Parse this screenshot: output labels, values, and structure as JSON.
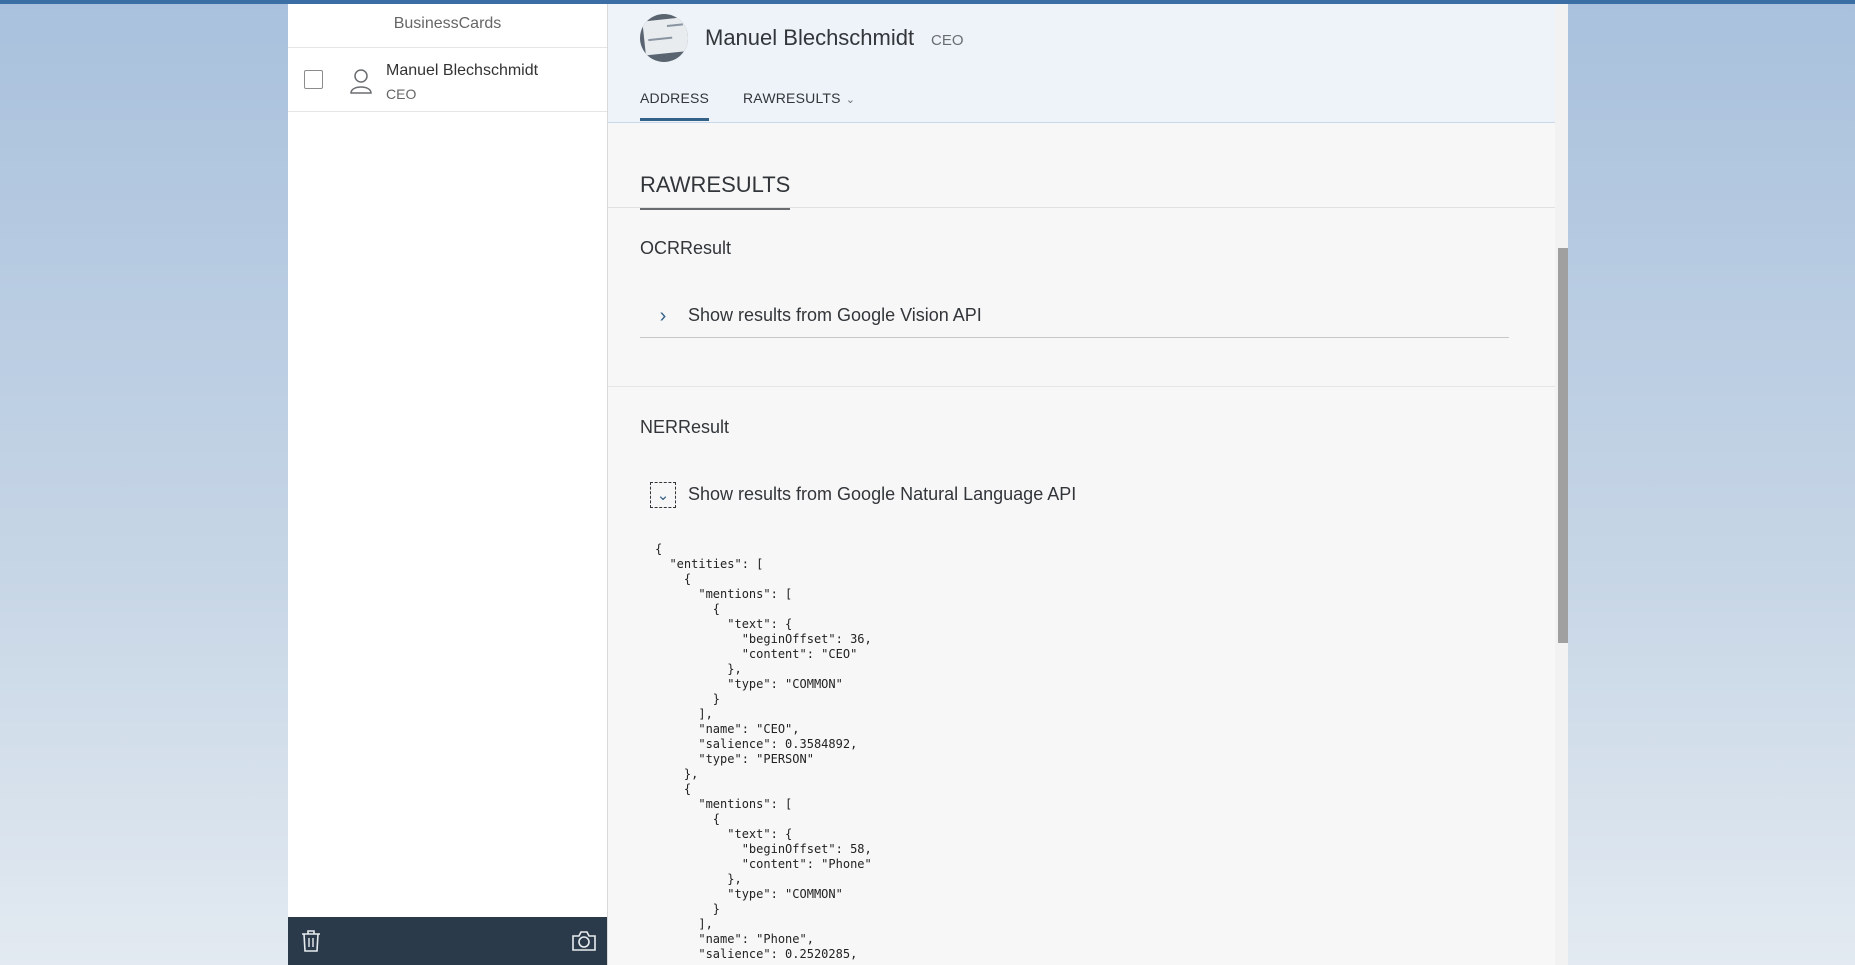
{
  "master": {
    "title": "BusinessCards",
    "items": [
      {
        "name": "Manuel Blechschmidt",
        "title": "CEO"
      }
    ],
    "footer": {
      "delete_icon": "trash-icon",
      "camera_icon": "camera-icon"
    }
  },
  "detail": {
    "header": {
      "title": "Manuel Blechschmidt",
      "subtitle": "CEO",
      "avatar": "business-card-thumbnail"
    },
    "tabs": [
      {
        "label": "ADDRESS",
        "selected": true
      },
      {
        "label": "RAWRESULTS",
        "selected": false,
        "icon": "chevron-down-icon"
      }
    ],
    "section_title": "RAWRESULTS",
    "ocr": {
      "title": "OCRResult",
      "panel_label": "Show results from Google Vision API",
      "expanded": false
    },
    "ner": {
      "title": "NERResult",
      "panel_label": "Show results from Google Natural Language API",
      "expanded": true,
      "json_text": "{\n  \"entities\": [\n    {\n      \"mentions\": [\n        {\n          \"text\": {\n            \"beginOffset\": 36,\n            \"content\": \"CEO\"\n          },\n          \"type\": \"COMMON\"\n        }\n      ],\n      \"name\": \"CEO\",\n      \"salience\": 0.3584892,\n      \"type\": \"PERSON\"\n    },\n    {\n      \"mentions\": [\n        {\n          \"text\": {\n            \"beginOffset\": 58,\n            \"content\": \"Phone\"\n          },\n          \"type\": \"COMMON\"\n        }\n      ],\n      \"name\": \"Phone\",\n      \"salience\": 0.2520285,"
    }
  },
  "colors": {
    "accent": "#346187",
    "footer_bg": "#2b3a4a",
    "header_bg": "#edf3f8"
  }
}
